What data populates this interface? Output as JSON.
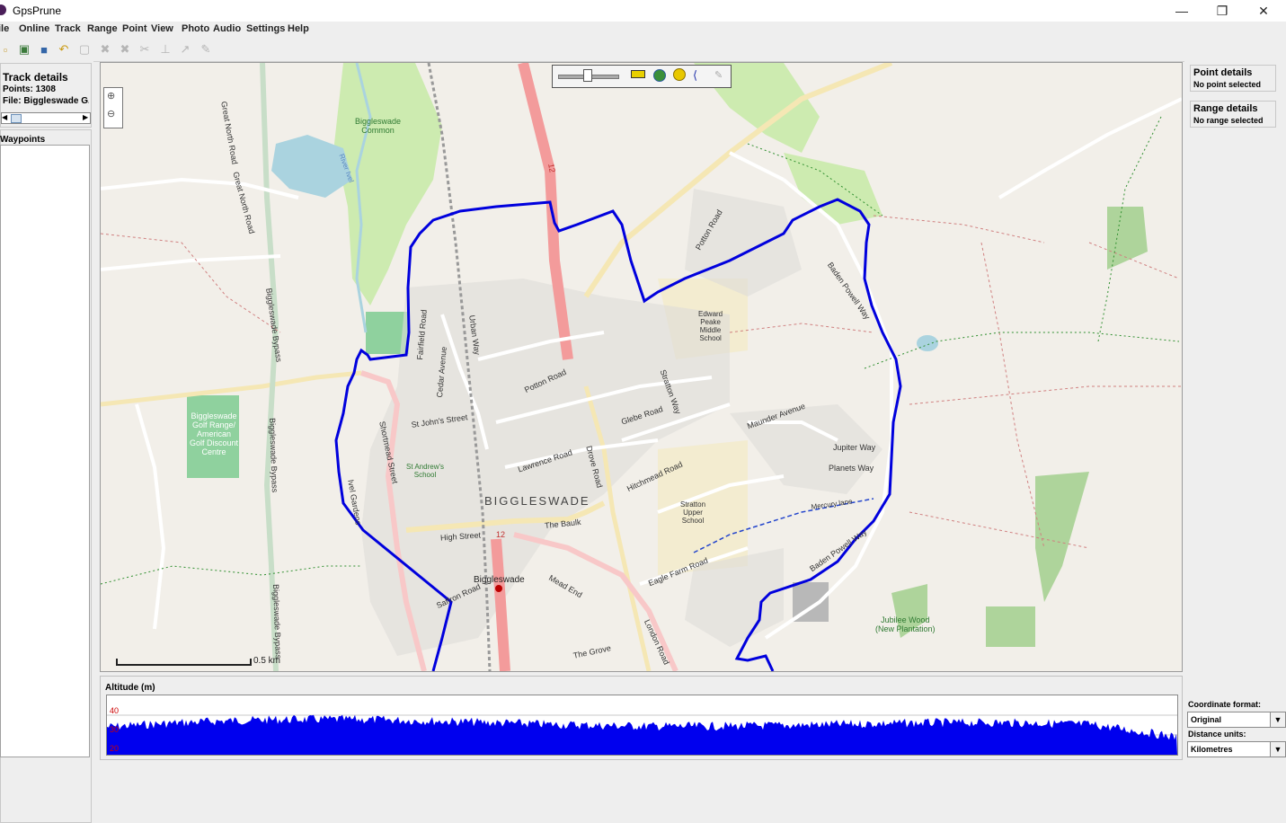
{
  "window": {
    "title": "GpsPrune",
    "minimize_glyph": "—",
    "restore_glyph": "❐",
    "close_glyph": "✕"
  },
  "menubar": [
    {
      "label": "ile",
      "underline": ""
    },
    {
      "label": "Online",
      "underline": "O"
    },
    {
      "label": "Track",
      "underline": "T"
    },
    {
      "label": "Range",
      "underline": "R"
    },
    {
      "label": "Point",
      "underline": "P"
    },
    {
      "label": "View",
      "underline": "V"
    },
    {
      "label": "Photo",
      "underline": "h"
    },
    {
      "label": "Audio",
      "underline": "A"
    },
    {
      "label": "Settings",
      "underline": "S"
    },
    {
      "label": "Help",
      "underline": "H"
    }
  ],
  "toolbar": {
    "icons": [
      "new-icon",
      "open-icon",
      "save-icon",
      "undo-icon",
      "edit-point-icon",
      "delete-point-icon",
      "delete-range-icon",
      "cut-move-icon",
      "connect-icon",
      "add-point-icon",
      "draw-icon"
    ],
    "glyphs": [
      "▫",
      "▣",
      "■",
      "↶",
      "▢",
      "✖",
      "✖",
      "✂",
      "⊥",
      "↗",
      "✎"
    ]
  },
  "left_panel": {
    "track_details": {
      "title": "Track details",
      "points": "Points: 1308",
      "file": "File: Biggleswade G..."
    },
    "waypoints_title": "Waypoints"
  },
  "map": {
    "zoom_in": "⊕",
    "zoom_out": "⊖",
    "scale_label": "0.5 km",
    "labels": {
      "biggleswade_common": "Biggleswade\nCommon",
      "river_ivel": "River Ivel",
      "great_north_road": "Great North Road",
      "biggleswade_bypass": "Biggleswade Bypass",
      "golf": "Biggleswade\nGolf Range/\nAmerican\nGolf Discount\nCentre",
      "town": "BIGGLESWADE",
      "station": "Biggleswade",
      "edward_peake": "Edward\nPeake\nMiddle\nSchool",
      "stratton_upper": "Stratton\nUpper\nSchool",
      "st_andrews": "St Andrew's\nSchool",
      "jubilee_wood": "Jubilee Wood\n(New Plantation)",
      "high_street": "High Street",
      "the_baulk": "The Baulk",
      "potton_road": "Potton Road",
      "drove_road": "Drove Road",
      "hitchmead_road": "Hitchmead Road",
      "eagle_farm_road": "Eagle Farm Road",
      "baden_powell_way": "Baden Powell Way",
      "baden_powell_way_2": "Baden Powell Way",
      "maunder_avenue": "Maunder Avenue",
      "jupiter_way": "Jupiter Way",
      "planets_way": "Planets Way",
      "mercury_lane": "Mercury lane",
      "lawrence_road": "Lawrence Road",
      "st_johns_street": "St John's Street",
      "shortmead_street": "Shortmead Street",
      "ivel_gardens": "Ivel Gardens",
      "london_road": "London Road",
      "mead_end": "Mead End",
      "the_grove": "The Grove",
      "saffron_road": "Saffron Road",
      "glebe_road": "Glebe Road",
      "stratton_way": "Stratton Way",
      "road_a1": "12",
      "road_a1_b": "12",
      "urban_way": "Urban Way",
      "fairfield_road": "Fairfield Road",
      "cedar_avenue": "Cedar Avenue"
    }
  },
  "profile": {
    "title": "Altitude (m)",
    "ticks": [
      "40",
      "30",
      "20"
    ]
  },
  "right_panel": {
    "point_details": {
      "title": "Point details",
      "status": "No point selected"
    },
    "range_details": {
      "title": "Range details",
      "status": "No range selected"
    },
    "coordinate_format_label": "Coordinate format:",
    "coordinate_format_value": "Original",
    "distance_units_label": "Distance units:",
    "distance_units_value": "Kilometres",
    "dropdown_glyph": "▼"
  }
}
